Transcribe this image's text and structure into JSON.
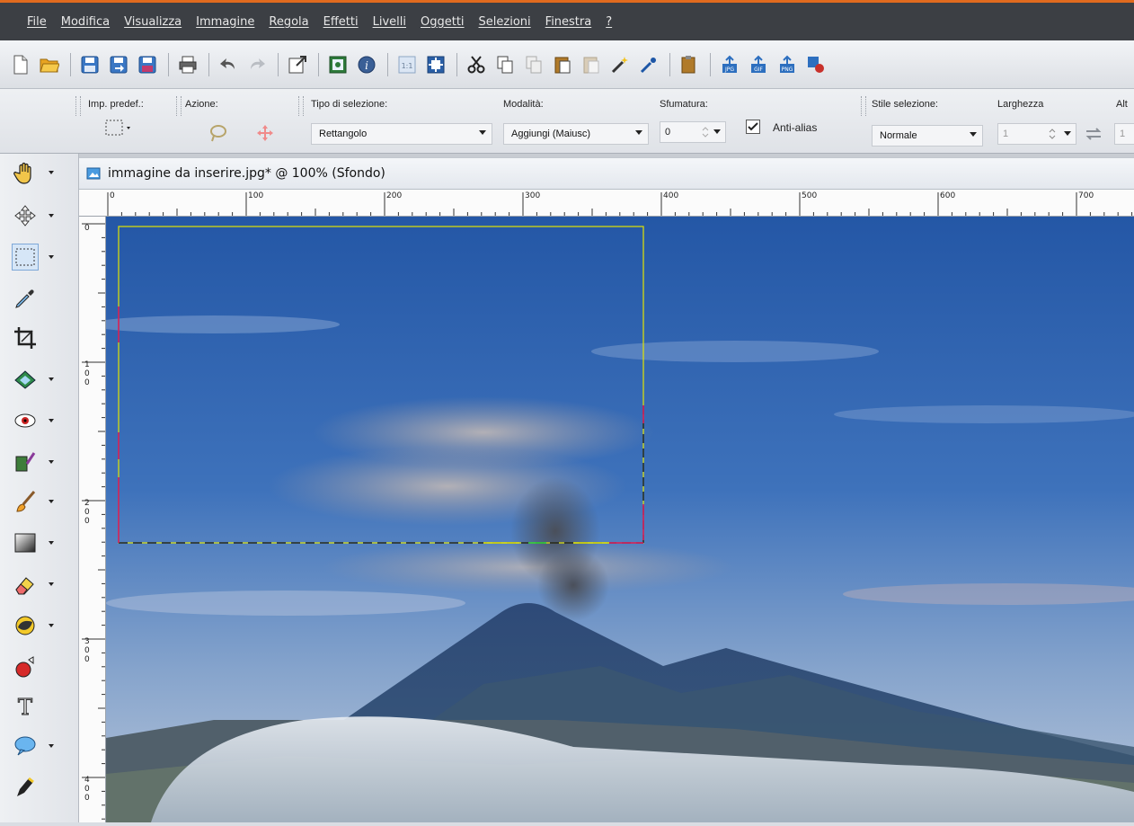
{
  "menu": [
    "File",
    "Modifica",
    "Visualizza",
    "Immagine",
    "Regola",
    "Effetti",
    "Livelli",
    "Oggetti",
    "Selezioni",
    "Finestra",
    "?"
  ],
  "options": {
    "preset_label": "Imp. predef.:",
    "action_label": "Azione:",
    "selection_type_label": "Tipo di selezione:",
    "selection_type_value": "Rettangolo",
    "mode_label": "Modalità:",
    "mode_value": "Aggiungi (Maiusc)",
    "feather_label": "Sfumatura:",
    "feather_value": "0",
    "antialias_label": "Anti-alias",
    "antialias_checked": true,
    "style_label": "Stile selezione:",
    "style_value": "Normale",
    "width_label": "Larghezza",
    "width_value": "1",
    "height_label": "Alt",
    "height_value": "1"
  },
  "document": {
    "title": "immagine da inserire.jpg* @ 100% (Sfondo)"
  },
  "rulers": {
    "top_labels": [
      "0",
      "100",
      "200",
      "300",
      "400",
      "500",
      "600",
      "700"
    ],
    "left_labels": [
      "0",
      "100",
      "200",
      "300",
      "400"
    ]
  },
  "colors": {
    "menubar_bg": "#3c3f44",
    "accent": "#e06a1e",
    "selection_marquee": "#e2e400"
  }
}
